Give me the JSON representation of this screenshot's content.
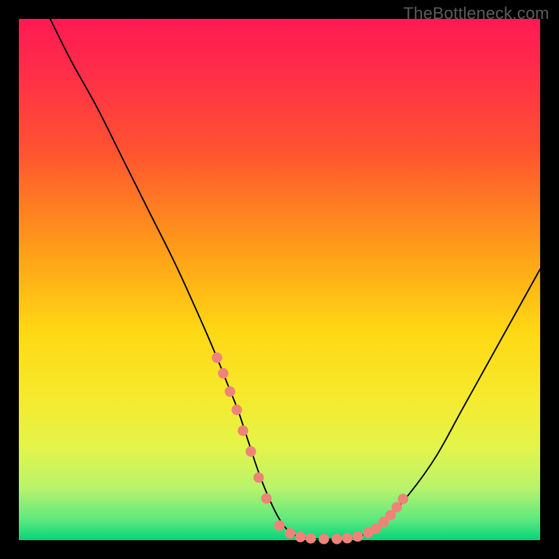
{
  "watermark_text": "TheBottleneck.com",
  "chart_data": {
    "type": "line",
    "title": "",
    "xlabel": "",
    "ylabel": "",
    "xlim": [
      0,
      100
    ],
    "ylim": [
      0,
      100
    ],
    "series": [
      {
        "name": "bottleneck-curve",
        "x": [
          6,
          10,
          15,
          20,
          25,
          30,
          35,
          38,
          40,
          42,
          44,
          46,
          48,
          50,
          52,
          54,
          56,
          58,
          60,
          62,
          64,
          66,
          70,
          75,
          80,
          85,
          90,
          95,
          100
        ],
        "values": [
          100,
          92,
          83,
          73,
          63,
          53,
          42,
          35,
          30,
          25,
          19,
          13,
          8,
          4,
          1.5,
          0.6,
          0.3,
          0.2,
          0.2,
          0.3,
          0.5,
          1.0,
          3.5,
          9,
          16,
          25,
          34,
          43,
          52
        ]
      }
    ],
    "markers": {
      "name": "highlight-dots",
      "color": "#f08378",
      "x": [
        38,
        39.2,
        40.5,
        41.8,
        43,
        44.5,
        46,
        47.5,
        50,
        52,
        54,
        56,
        58.5,
        61,
        63,
        65,
        67,
        68.5,
        70,
        71.3,
        72.5,
        73.7
      ],
      "values": [
        35,
        32,
        28.5,
        25,
        21,
        17,
        12,
        8,
        2.8,
        1.3,
        0.6,
        0.35,
        0.22,
        0.22,
        0.38,
        0.7,
        1.4,
        2.2,
        3.5,
        4.8,
        6.3,
        7.9
      ]
    },
    "background_gradient": {
      "top": "#ff1a52",
      "mid1": "#ffa018",
      "mid2": "#ffd814",
      "bottom": "#05d47c"
    }
  }
}
